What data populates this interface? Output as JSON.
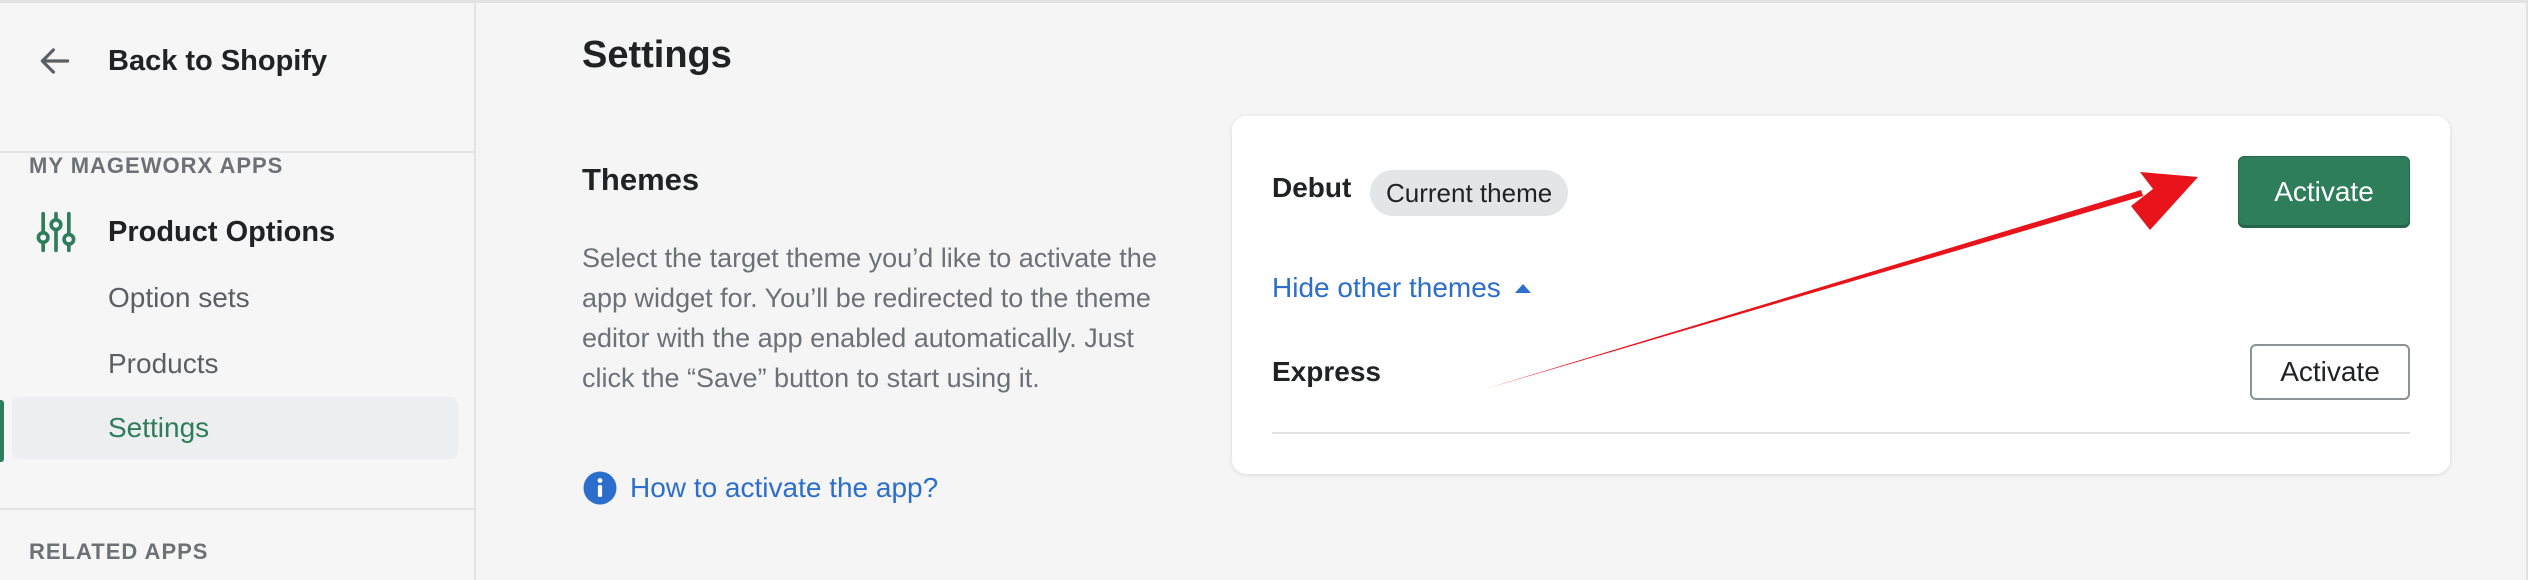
{
  "sidebar": {
    "back_label": "Back to Shopify",
    "section_my_apps": "MY MAGEWORX APPS",
    "app_name": "Product Options",
    "items": [
      {
        "label": "Option sets"
      },
      {
        "label": "Products"
      },
      {
        "label": "Settings"
      }
    ],
    "active_item": "Settings",
    "section_related": "RELATED APPS"
  },
  "main": {
    "page_title": "Settings",
    "themes_title": "Themes",
    "description": "Select the target theme you’d like to activate the app widget for. You’ll be redirected to the theme editor with the app enabled automatically. Just click the “Save” button to start using it.",
    "help_link": "How to activate the app?"
  },
  "themes_card": {
    "current": {
      "name": "Debut",
      "badge": "Current theme",
      "button": "Activate"
    },
    "toggle_link": "Hide other themes",
    "others": [
      {
        "name": "Express",
        "button": "Activate"
      }
    ]
  },
  "colors": {
    "accent_green": "#2e7d5b",
    "link_blue": "#2c6ecb",
    "annotation_red": "#e8131b"
  },
  "icons": [
    "arrow-left-icon",
    "sliders-icon",
    "info-icon",
    "caret-up-icon"
  ]
}
